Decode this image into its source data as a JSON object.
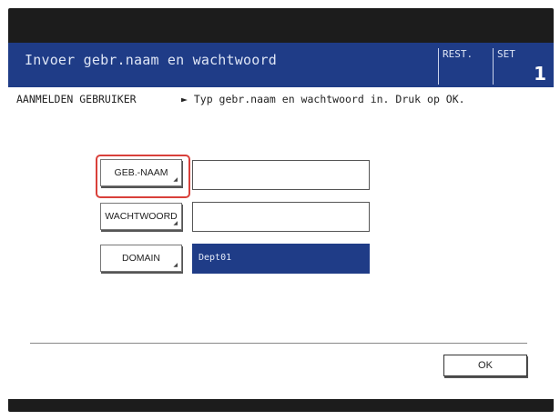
{
  "header": {
    "title": "Invoer gebr.naam en wachtwoord",
    "rest_label": "REST.",
    "set_label": "SET",
    "set_number": "1"
  },
  "status": {
    "breadcrumb": "AANMELDEN GEBRUIKER",
    "instruction": "► Typ gebr.naam en wachtwoord in. Druk op OK."
  },
  "form": {
    "username_button": "GEB.-NAAM",
    "username_value": "",
    "password_button": "WACHTWOORD",
    "password_value": "",
    "domain_button": "DOMAIN",
    "domain_value": "Dept01"
  },
  "footer": {
    "ok_label": "OK"
  },
  "colors": {
    "titlebar": "#1f3c87",
    "highlight": "#d9403a",
    "selected_field": "#1f3c87"
  }
}
